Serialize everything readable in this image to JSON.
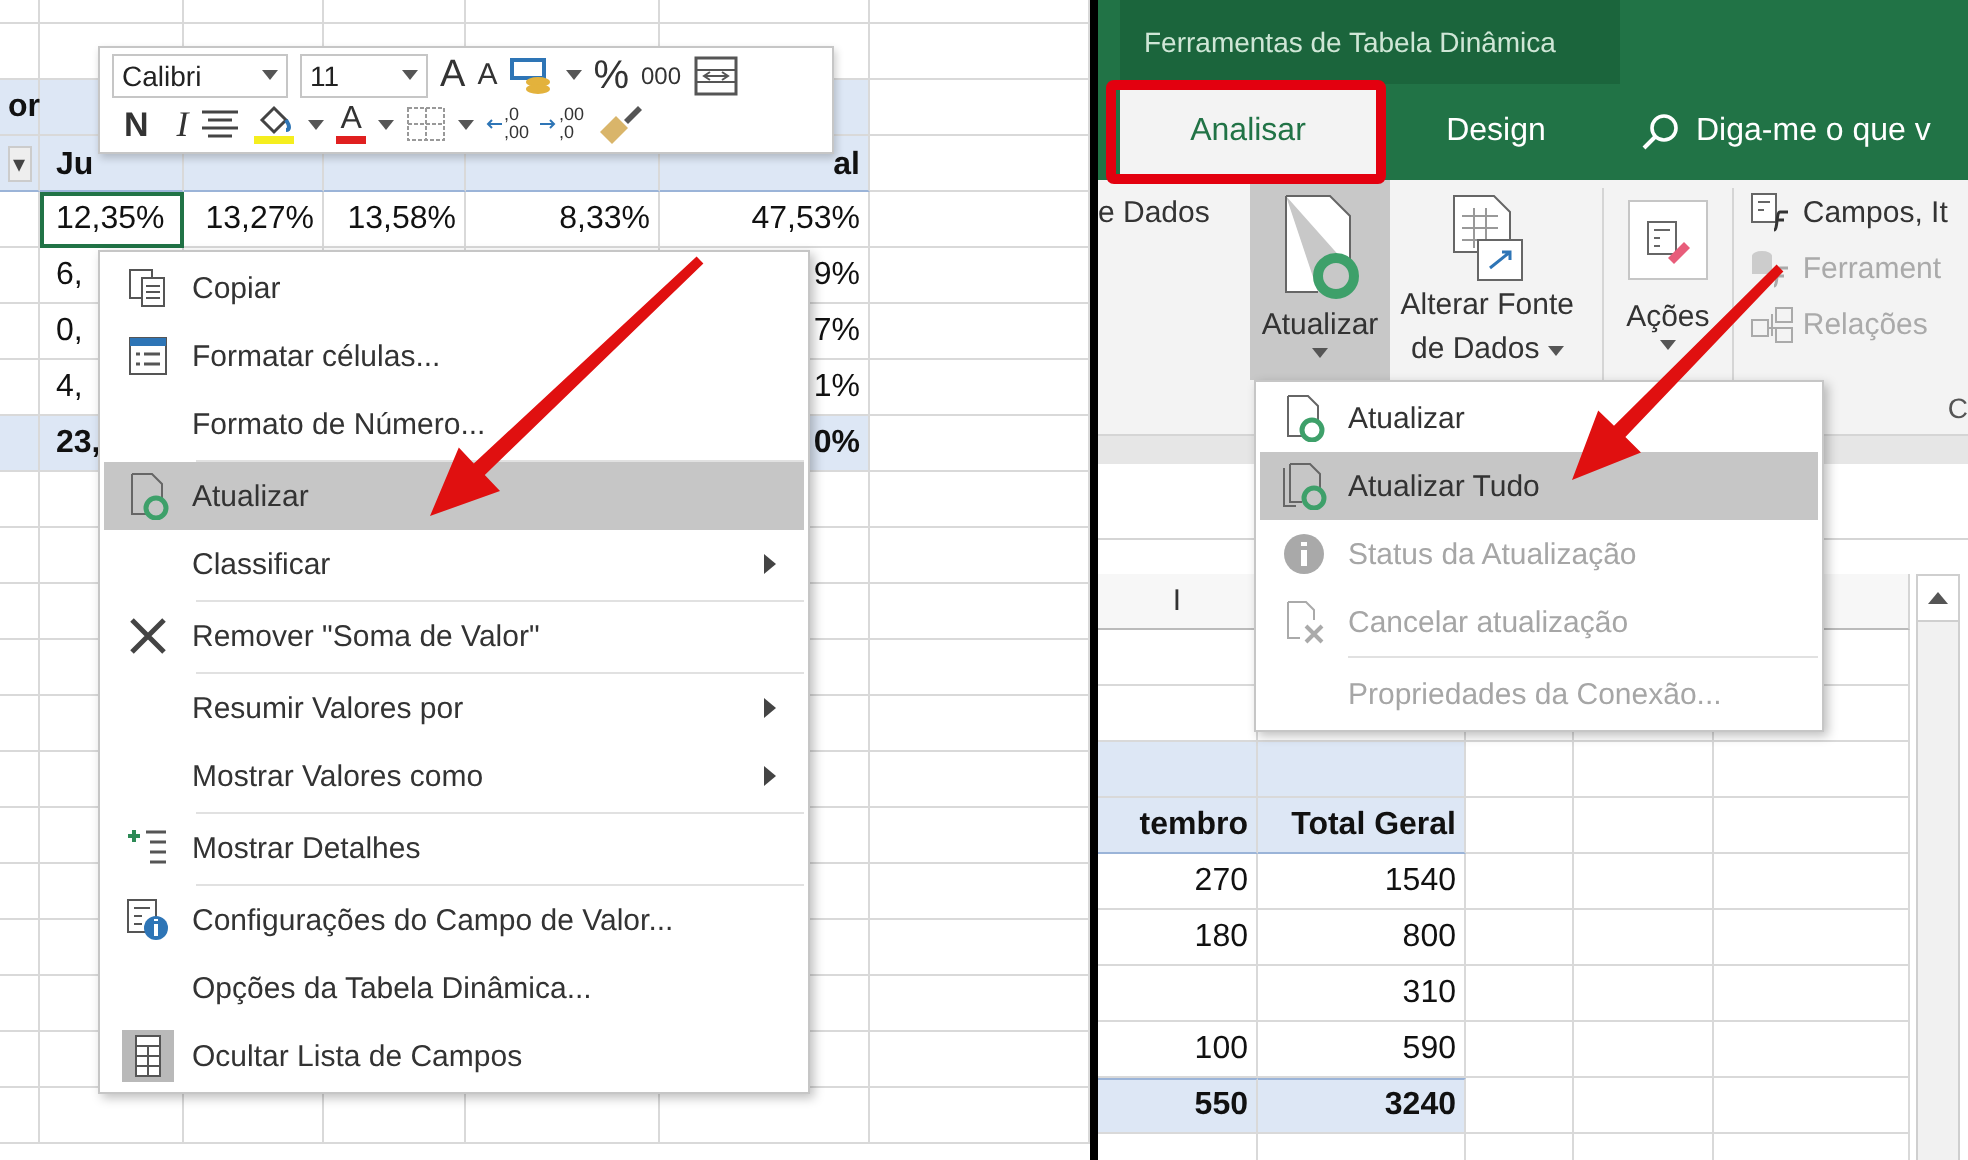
{
  "left_sheet": {
    "rows": [
      {
        "kind": "title",
        "selected": false,
        "column_1": "or"
      },
      {
        "kind": "header",
        "selected": false,
        "filter": "▾",
        "column_2": "Ju",
        "column_6": "al"
      },
      {
        "kind": "data",
        "selected": true,
        "column_2": "12,35%",
        "column_3": "13,27%",
        "column_4": "13,58%",
        "column_5": "8,33%",
        "column_6": "47,53%"
      },
      {
        "kind": "data",
        "selected": false,
        "column_2": "6,",
        "column_6": "9%"
      },
      {
        "kind": "data",
        "selected": false,
        "column_2": "0,",
        "column_6": "7%"
      },
      {
        "kind": "data",
        "selected": false,
        "column_2": "4,",
        "column_6": "1%"
      },
      {
        "kind": "total",
        "selected": false,
        "column_2": "23,",
        "column_6": "0%"
      }
    ]
  },
  "mini_toolbar": {
    "font": "Calibri",
    "size": "11",
    "grow_font": "A",
    "shrink_font": "A",
    "percent": "%",
    "thousands": "000",
    "bold": "N",
    "italic": "I",
    "font_color": "A",
    "increase_decimal": {
      "top": ",0",
      "bottom": ",00"
    },
    "decrease_decimal": {
      "top": ",00",
      "bottom": ",0"
    }
  },
  "context_menu": [
    {
      "label": "Copiar",
      "kind": "copy",
      "submenu": false,
      "selected": false,
      "divider_after": false
    },
    {
      "label": "Formatar células...",
      "kind": "format",
      "submenu": false,
      "selected": false,
      "divider_after": false
    },
    {
      "label": "Formato de Número...",
      "kind": "plain",
      "submenu": false,
      "selected": false,
      "divider_after": true
    },
    {
      "label": "Atualizar",
      "kind": "refresh",
      "submenu": false,
      "selected": true,
      "divider_after": false
    },
    {
      "label": "Classificar",
      "kind": "plain",
      "submenu": true,
      "selected": false,
      "divider_after": true
    },
    {
      "label": "Remover \"Soma de Valor\"",
      "kind": "remove",
      "submenu": false,
      "selected": false,
      "divider_after": true
    },
    {
      "label": "Resumir Valores por",
      "kind": "plain",
      "submenu": true,
      "selected": false,
      "divider_after": false
    },
    {
      "label": "Mostrar Valores como",
      "kind": "plain",
      "submenu": true,
      "selected": false,
      "divider_after": true
    },
    {
      "label": "Mostrar Detalhes",
      "kind": "details",
      "submenu": false,
      "selected": false,
      "divider_after": true
    },
    {
      "label": "Configurações do Campo de Valor...",
      "kind": "settings",
      "submenu": false,
      "selected": false,
      "divider_after": false
    },
    {
      "label": "Opções da Tabela Dinâmica...",
      "kind": "plain",
      "submenu": false,
      "selected": false,
      "divider_after": false
    },
    {
      "label": "Ocultar Lista de Campos",
      "kind": "fieldlist",
      "submenu": false,
      "selected": false,
      "divider_after": false
    }
  ],
  "ribbon": {
    "context_title": "Ferramentas de Tabela Dinâmica",
    "tabs": [
      {
        "label": "Analisar",
        "selected": true
      },
      {
        "label": "Design",
        "selected": false
      }
    ],
    "search": {
      "placeholder": "Diga-me o que v"
    },
    "cut_label": "e Dados",
    "buttons": [
      {
        "kind": "refresh",
        "lines": [
          "Atualizar"
        ],
        "selected": true
      },
      {
        "kind": "source",
        "lines": [
          "Alterar Fonte",
          "de Dados"
        ],
        "selected": false
      },
      {
        "kind": "actions",
        "lines": [
          "Ações"
        ],
        "selected": false
      }
    ],
    "commands": [
      {
        "kind": "fields",
        "label": "Campos, It",
        "disabled": false
      },
      {
        "kind": "tools",
        "label": "Ferrament",
        "disabled": true
      },
      {
        "kind": "relations",
        "label": "Relações",
        "disabled": true
      }
    ],
    "group_label": "C"
  },
  "refresh_menu": [
    {
      "label": "Atualizar",
      "kind": "refresh",
      "selected": false,
      "disabled": false,
      "divider_before": false
    },
    {
      "label": "Atualizar Tudo",
      "kind": "refresh_all",
      "selected": true,
      "disabled": false,
      "divider_before": false
    },
    {
      "label": "Status da Atualização",
      "kind": "info",
      "selected": false,
      "disabled": true,
      "divider_before": false
    },
    {
      "label": "Cancelar atualização",
      "kind": "cancel",
      "selected": false,
      "disabled": true,
      "divider_before": false
    },
    {
      "label": "Propriedades da Conexão...",
      "kind": "plain",
      "selected": false,
      "disabled": true,
      "divider_before": true
    }
  ],
  "right_sheet": {
    "column_header": "I",
    "rows": [
      {
        "kind": "header",
        "column_1": "tembro",
        "column_2": "Total Geral"
      },
      {
        "kind": "data",
        "column_1": "270",
        "column_2": "1540"
      },
      {
        "kind": "data",
        "column_1": "180",
        "column_2": "800"
      },
      {
        "kind": "data",
        "column_2": "310"
      },
      {
        "kind": "data",
        "column_1": "100",
        "column_2": "590"
      },
      {
        "kind": "total",
        "column_1": "550",
        "column_2": "3240"
      }
    ]
  },
  "annotations": [
    {
      "kind": "arrow"
    },
    {
      "kind": "arrow"
    },
    {
      "kind": "frame"
    }
  ]
}
